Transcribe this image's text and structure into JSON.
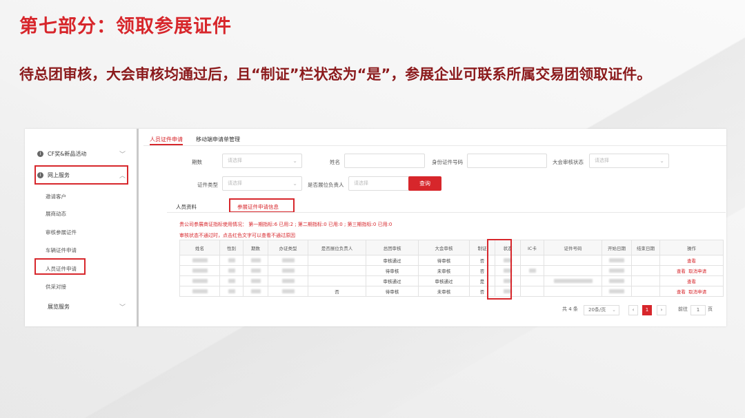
{
  "slide": {
    "title": "第七部分：领取参展证件",
    "subtitle": "待总团审核，大会审核均通过后，且“制证”栏状态为“是”，参展企业可联系所属交易团领取证件。"
  },
  "sidebar": {
    "items": [
      {
        "label": "CF奖&新品活动",
        "icon": "info-icon"
      },
      {
        "label": "网上服务",
        "icon": "info-icon"
      },
      {
        "label": "展览服务",
        "icon": ""
      }
    ],
    "subitems": [
      "邀请客户",
      "展商动态",
      "审核参展证件",
      "车辆证件申请",
      "人员证件申请",
      "供采对接"
    ]
  },
  "tabs": {
    "top": [
      "人员证件申请",
      "移动端申请单管理"
    ],
    "sub": [
      "人员资料",
      "参展证件申请信息"
    ]
  },
  "filters": {
    "period_label": "期数",
    "period_placeholder": "请选择",
    "name_label": "姓名",
    "name_value": "",
    "id_label": "身份证件号码",
    "id_value": "",
    "review_label": "大会审核状态",
    "review_placeholder": "请选择",
    "cert_type_label": "证件类型",
    "cert_type_placeholder": "请选择",
    "booth_head_label": "是否展位负责人",
    "booth_head_placeholder": "请选择",
    "query_button": "查询"
  },
  "notice": {
    "quota": "贵公司参展商证指标使用情况： 第一期指标:6 已用:2 ; 第二期指标:0 已用:0 ; 第三期指标:0 已用:0",
    "hint": "审核状态不通过时，点击红色文字可以查看不通过原因"
  },
  "table": {
    "headers": [
      "姓名",
      "性别",
      "期数",
      "办证类型",
      "是否展位负责人",
      "总团审核",
      "大会审核",
      "制证",
      "状态",
      "IC卡",
      "证件号码",
      "开始日期",
      "结束日期",
      "操作"
    ],
    "rows": [
      {
        "booth_head": "",
        "group_review": "审核通过",
        "fair_review": "待审核",
        "made": "否",
        "actions": [
          "查看"
        ]
      },
      {
        "booth_head": "",
        "group_review": "待审核",
        "fair_review": "未审核",
        "made": "否",
        "actions": [
          "查看",
          "取消申请"
        ]
      },
      {
        "booth_head": "",
        "group_review": "审核通过",
        "fair_review": "审核通过",
        "made": "是",
        "actions": [
          "查看"
        ]
      },
      {
        "booth_head": "否",
        "group_review": "待审核",
        "fair_review": "未审核",
        "made": "否",
        "actions": [
          "查看",
          "取消申请"
        ]
      }
    ]
  },
  "pager": {
    "total": "共 4 条",
    "page_size": "20条/页",
    "current": "1",
    "goto_label": "前往",
    "goto_value": "1",
    "page_unit": "页"
  }
}
